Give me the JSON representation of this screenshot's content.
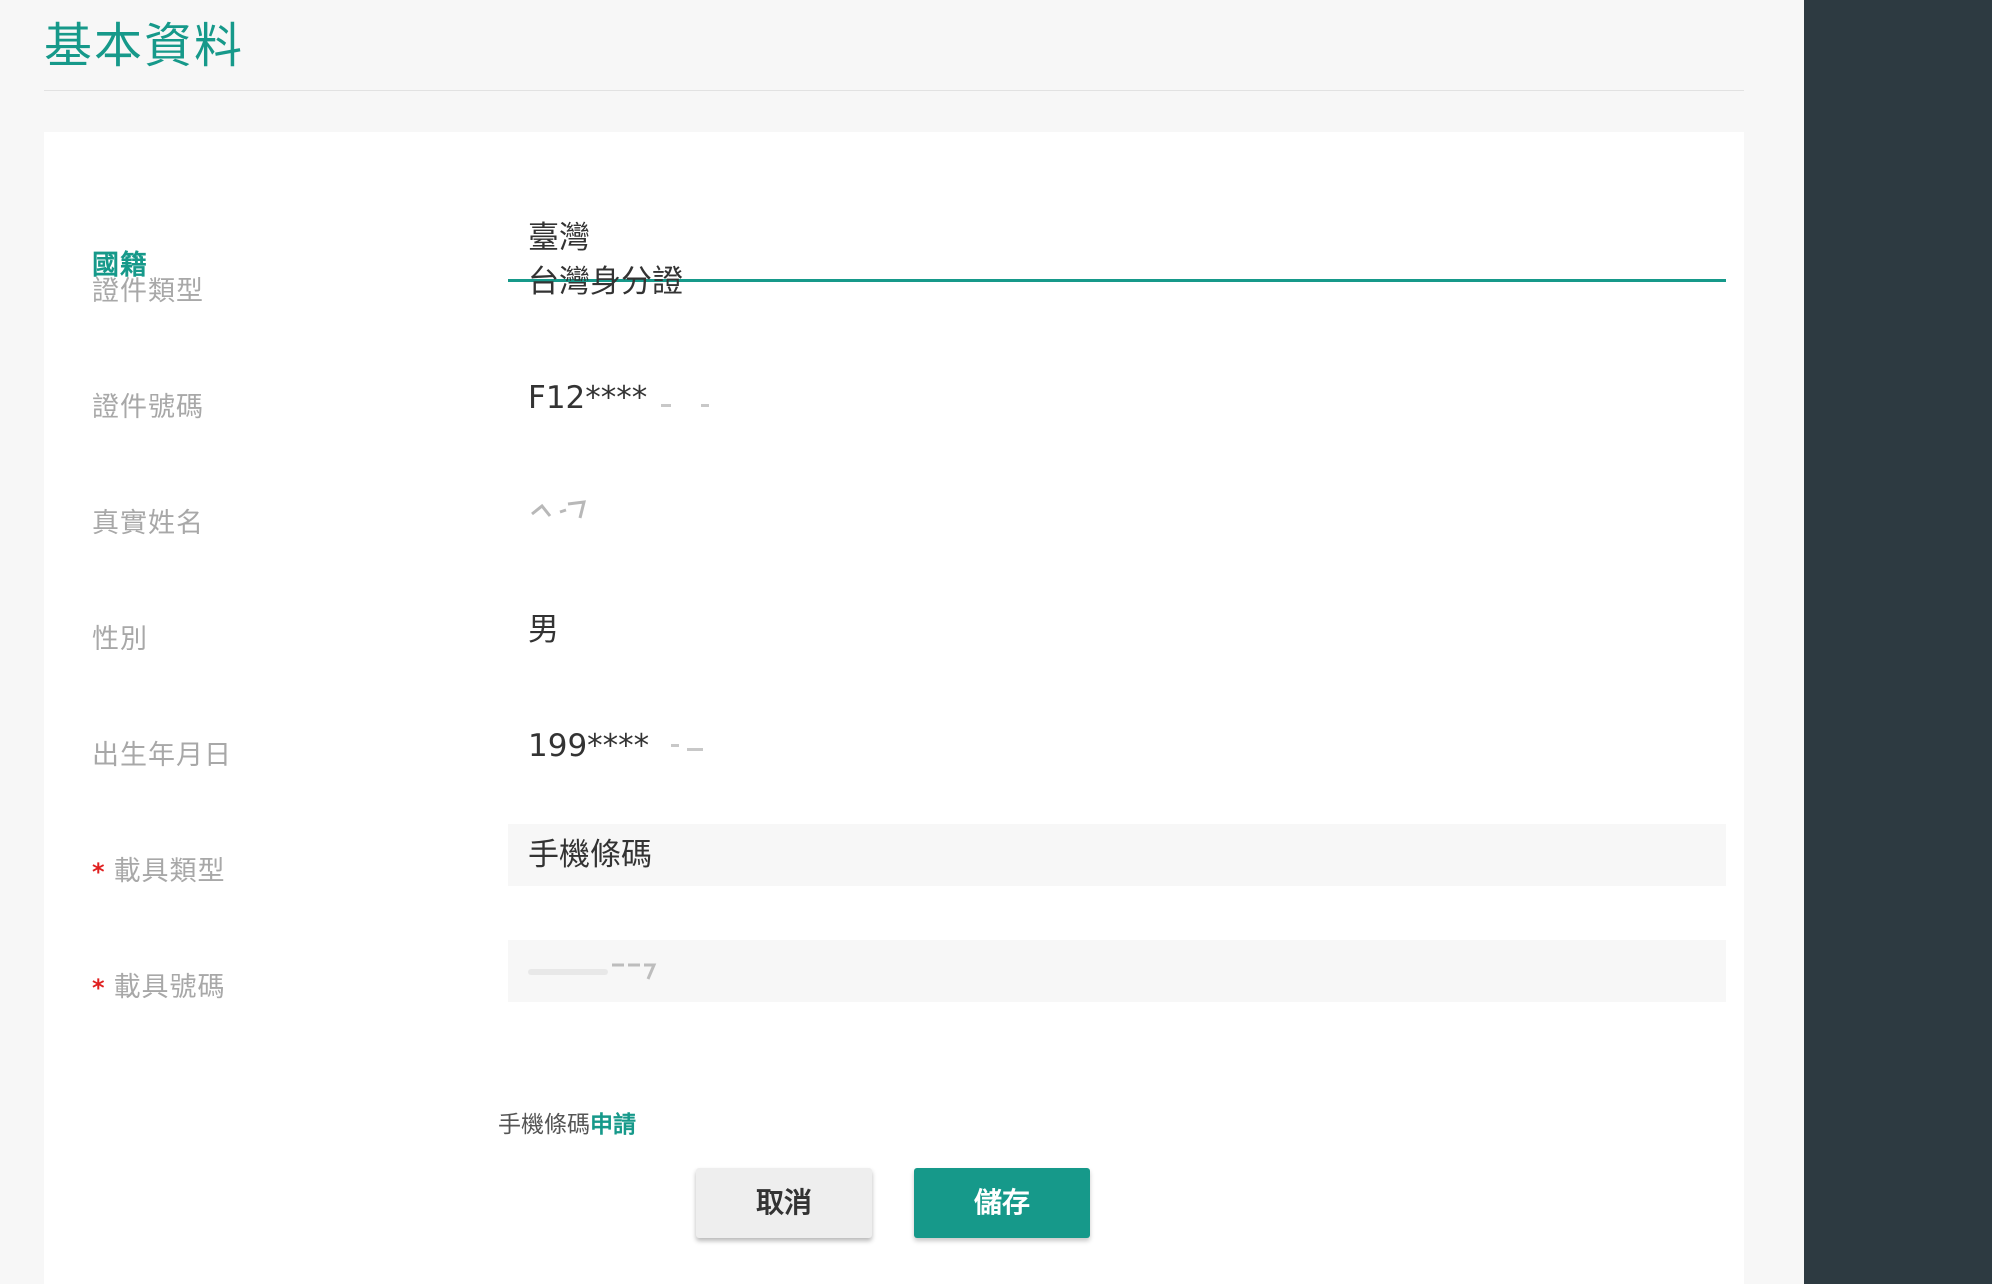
{
  "header": {
    "title": "基本資料"
  },
  "form": {
    "nationality": {
      "label": "國籍",
      "value": "臺灣"
    },
    "id_type": {
      "label": "證件類型",
      "value": "台灣身分證"
    },
    "id_number": {
      "label": "證件號碼",
      "value": "F12****"
    },
    "real_name": {
      "label": "真實姓名",
      "value": ""
    },
    "gender": {
      "label": "性別",
      "value": "男"
    },
    "birthday": {
      "label": "出生年月日",
      "value": "199****"
    },
    "carrier_type": {
      "label": "載具類型",
      "value": "手機條碼",
      "required_mark": "*"
    },
    "carrier_number": {
      "label": "載具號碼",
      "value": "",
      "required_mark": "*"
    }
  },
  "hint": {
    "text": "手機條碼",
    "link": "申請"
  },
  "buttons": {
    "cancel": "取消",
    "save": "儲存"
  },
  "colors": {
    "accent": "#16998a",
    "sidebar": "#2d3a41",
    "required": "#e02020"
  }
}
